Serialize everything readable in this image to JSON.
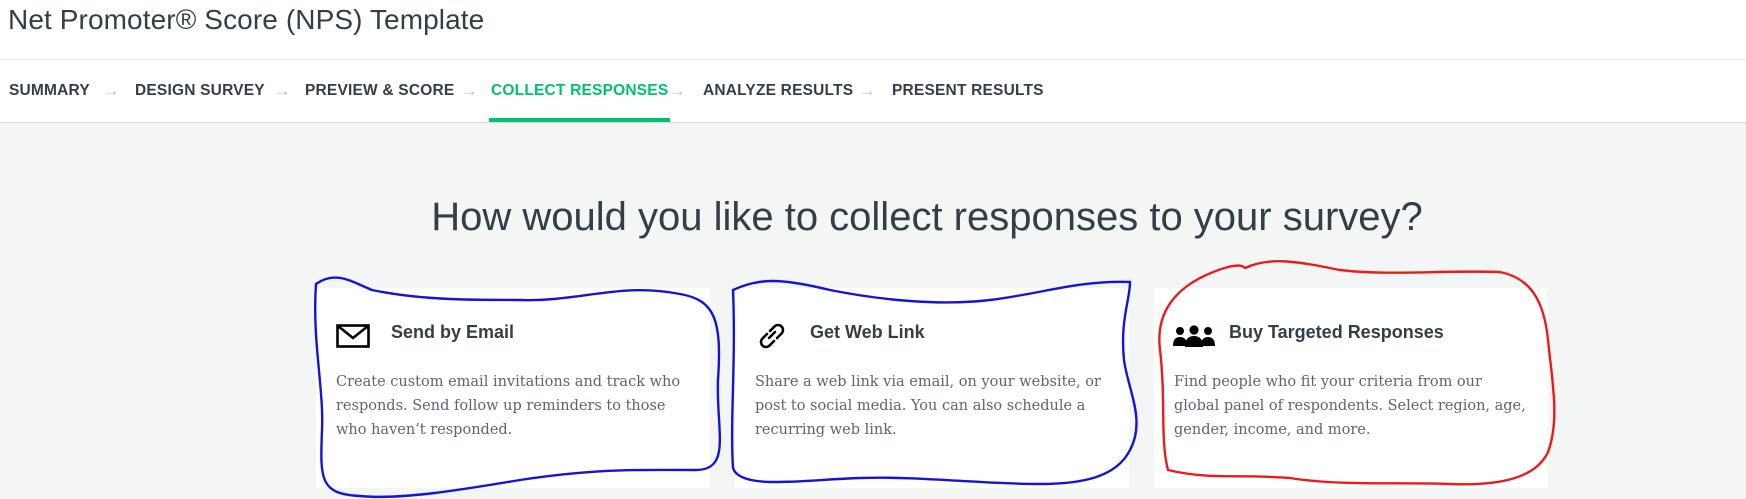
{
  "page": {
    "title": "Net Promoter® Score (NPS) Template"
  },
  "steps": [
    {
      "label": "SUMMARY",
      "active": false
    },
    {
      "label": "DESIGN SURVEY",
      "active": false
    },
    {
      "label": "PREVIEW & SCORE",
      "active": false
    },
    {
      "label": "COLLECT RESPONSES",
      "active": true
    },
    {
      "label": "ANALYZE RESULTS",
      "active": false
    },
    {
      "label": "PRESENT RESULTS",
      "active": false
    }
  ],
  "main": {
    "question": "How would you like to collect responses to your survey?"
  },
  "cards": [
    {
      "icon": "envelope-icon",
      "title": "Send by Email",
      "desc_lines": [
        "Create custom email invitations and track who",
        "responds. Send follow up reminders to those",
        "who haven’t responded."
      ]
    },
    {
      "icon": "link-icon",
      "title": "Get Web Link",
      "desc_lines": [
        "Share a web link via email, on your website, or",
        "post to social media. You can also schedule a",
        "recurring web link."
      ]
    },
    {
      "icon": "people-icon",
      "title": "Buy Targeted Responses",
      "desc_lines": [
        "Find people who fit your criteria from our",
        "global panel of respondents. Select region, age,",
        "gender, income, and more."
      ]
    }
  ],
  "colors": {
    "accent": "#00bf6f",
    "text": "#333e48",
    "background": "#f4f5f5",
    "annotation_blue": "#1414d6",
    "annotation_red": "#e81c1c"
  }
}
